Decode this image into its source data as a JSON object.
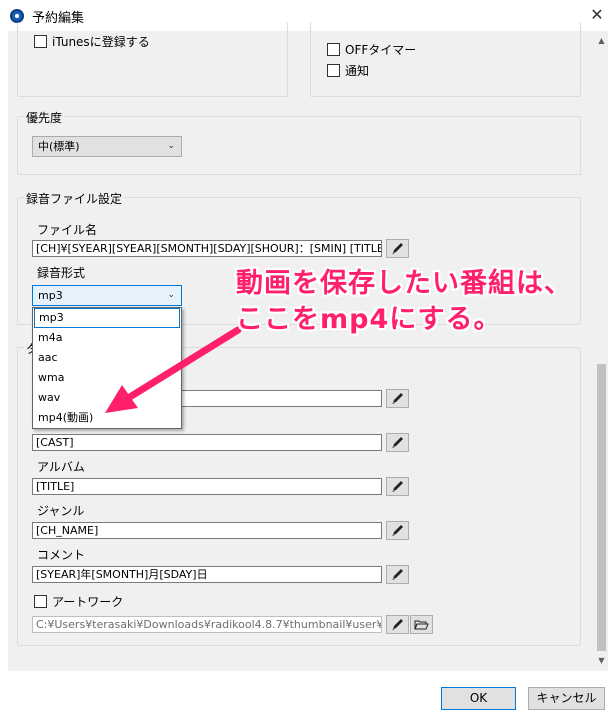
{
  "window": {
    "title": "予約編集",
    "close_glyph": "✕"
  },
  "top_section": {
    "itunes_label": "iTunesに登録する",
    "off_timer_label": "OFFタイマー",
    "notify_label": "通知"
  },
  "priority": {
    "group_title": "優先度",
    "value": "中(標準)"
  },
  "recording_file": {
    "group_title": "録音ファイル設定",
    "filename_label": "ファイル名",
    "filename_value": "[CH]¥[SYEAR][SYEAR][SMONTH][SDAY][SHOUR]：[SMIN] [TITLE]",
    "format_label": "録音形式",
    "format_value": "mp3",
    "format_options": [
      "mp3",
      "m4a",
      "aac",
      "wma",
      "wav",
      "mp4(動画)"
    ]
  },
  "tags": {
    "group_title_fragment": "タ",
    "field1_value": "",
    "artist_value": "[CAST]",
    "album_label": "アルバム",
    "album_value": "[TITLE]",
    "genre_label": "ジャンル",
    "genre_value": "[CH_NAME]",
    "comment_label": "コメント",
    "comment_value": "[SYEAR]年[SMONTH]月[SDAY]日",
    "artwork_label": "アートワーク",
    "artwork_path": "C:¥Users¥terasaki¥Downloads¥radikool4.8.7¥thumbnail¥user¥ag.p"
  },
  "annotation": {
    "line1": "動画を保存したい番組は、",
    "line2": "ここをmp4にする。",
    "color": "#ff1f6b"
  },
  "buttons": {
    "ok": "OK",
    "cancel": "キャンセル"
  },
  "icons": {
    "edit": "pencil-icon",
    "browse": "folder-open-icon"
  }
}
